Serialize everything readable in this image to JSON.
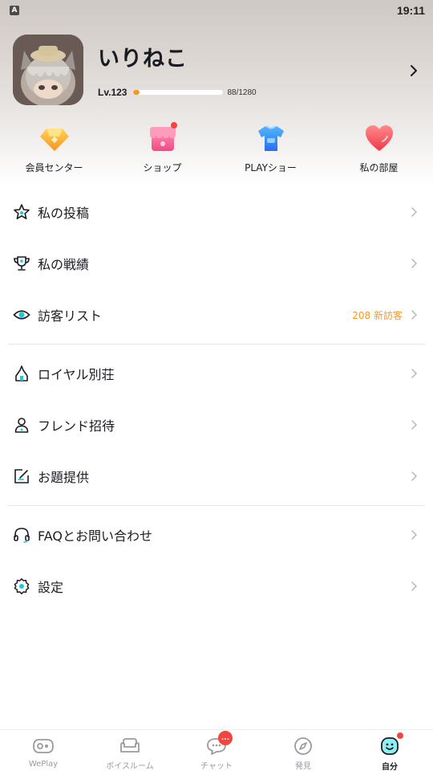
{
  "status_bar": {
    "badge": "A",
    "time": "19:11"
  },
  "profile": {
    "username": "いりねこ",
    "level_label": "Lv.123",
    "xp_text": "88/1280",
    "xp_fraction": 0.069
  },
  "quick_actions": [
    {
      "label": "会員センター",
      "icon": "diamond-icon",
      "has_dot": false
    },
    {
      "label": "ショップ",
      "icon": "shop-icon",
      "has_dot": true
    },
    {
      "label": "PLAYショー",
      "icon": "tshirt-icon",
      "has_dot": false
    },
    {
      "label": "私の部屋",
      "icon": "heart-icon",
      "has_dot": false
    }
  ],
  "menu_group1": [
    {
      "label": "私の投稿",
      "icon": "star-icon",
      "extra": ""
    },
    {
      "label": "私の戦績",
      "icon": "trophy-icon",
      "extra": ""
    },
    {
      "label": "訪客リスト",
      "icon": "eye-icon",
      "extra": "208 新訪客"
    }
  ],
  "menu_group2": [
    {
      "label": "ロイヤル別荘",
      "icon": "villa-icon",
      "extra": ""
    },
    {
      "label": "フレンド招待",
      "icon": "person-icon",
      "extra": ""
    },
    {
      "label": "お題提供",
      "icon": "edit-icon",
      "extra": ""
    }
  ],
  "menu_group3": [
    {
      "label": "FAQとお問い合わせ",
      "icon": "headset-icon",
      "extra": ""
    },
    {
      "label": "設定",
      "icon": "gear-icon",
      "extra": ""
    }
  ],
  "tabs": [
    {
      "label": "WePlay",
      "icon": "weplay-icon",
      "active": false
    },
    {
      "label": "ボイスルーム",
      "icon": "sofa-icon",
      "active": false
    },
    {
      "label": "チャット",
      "icon": "chat-icon",
      "active": false,
      "badge": "..."
    },
    {
      "label": "発見",
      "icon": "compass-icon",
      "active": false
    },
    {
      "label": "自分",
      "icon": "face-icon",
      "active": true
    }
  ],
  "colors": {
    "accent_orange": "#f39a24",
    "visitor_orange": "#f29a2e",
    "badge_red": "#f2453d",
    "active_tab": "#1fc8d6"
  }
}
